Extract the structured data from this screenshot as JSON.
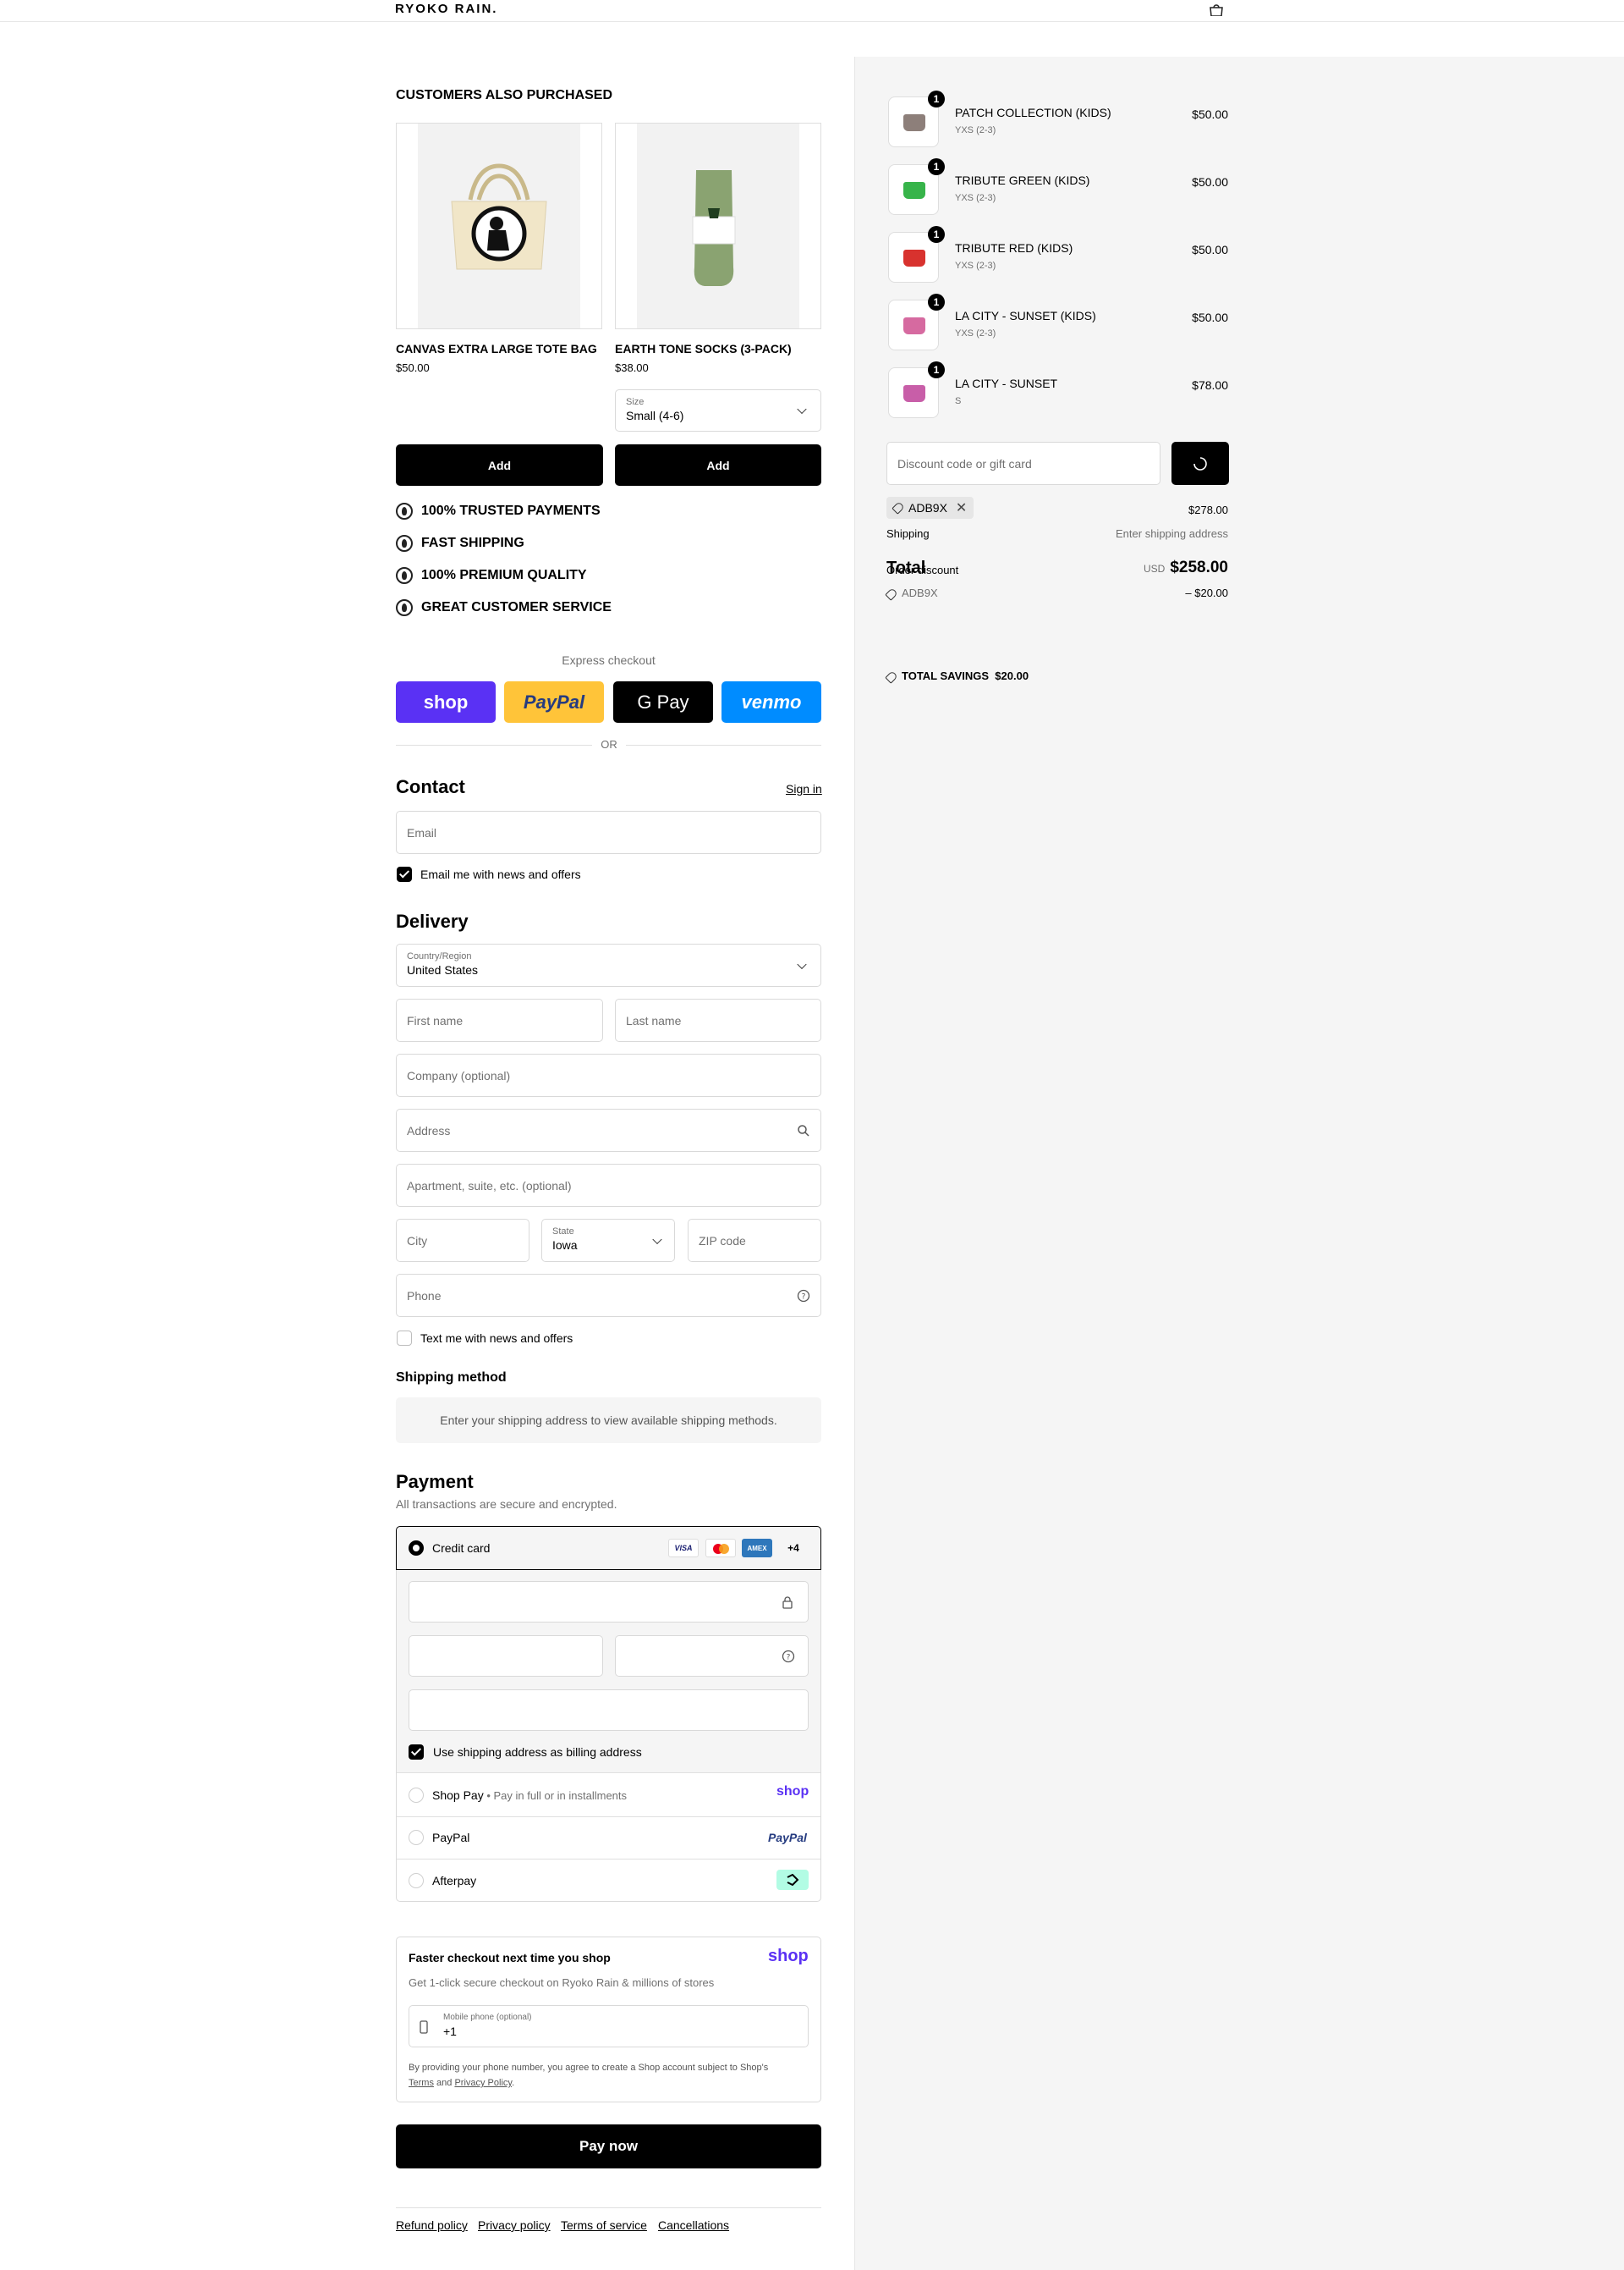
{
  "header": {
    "logo": "RYOKO RAIN."
  },
  "upsell": {
    "title": "CUSTOMERS ALSO PURCHASED",
    "products": [
      {
        "name": "CANVAS EXTRA LARGE TOTE BAG",
        "price": "$50.00",
        "add_label": "Add"
      },
      {
        "name": "EARTH TONE SOCKS (3-PACK)",
        "price": "$38.00",
        "size_label": "Size",
        "size_value": "Small (4-6)",
        "add_label": "Add"
      }
    ]
  },
  "trust": [
    "100% TRUSTED PAYMENTS",
    "FAST SHIPPING",
    "100% PREMIUM QUALITY",
    "GREAT CUSTOMER SERVICE"
  ],
  "express": {
    "title": "Express checkout",
    "buttons": [
      "shop",
      "PayPal",
      "G Pay",
      "venmo"
    ],
    "or": "OR"
  },
  "contact": {
    "title": "Contact",
    "sign_in": "Sign in",
    "email_placeholder": "Email",
    "newsletter": "Email me with news and offers"
  },
  "delivery": {
    "title": "Delivery",
    "country_label": "Country/Region",
    "country_value": "United States",
    "first_name": "First name",
    "last_name": "Last name",
    "company": "Company (optional)",
    "address": "Address",
    "apartment": "Apartment, suite, etc. (optional)",
    "city": "City",
    "state_label": "State",
    "state_value": "Iowa",
    "zip": "ZIP code",
    "phone": "Phone",
    "sms": "Text me with news and offers"
  },
  "shipping_method": {
    "title": "Shipping method",
    "notice": "Enter your shipping address to view available shipping methods."
  },
  "payment": {
    "title": "Payment",
    "subtitle": "All transactions are secure and encrypted.",
    "credit_card": "Credit card",
    "card_brands": [
      "VISA",
      "",
      "AMEX"
    ],
    "more_brands": "+4",
    "billing_same": "Use shipping address as billing address",
    "shop_pay": "Shop Pay",
    "shop_pay_sub": "Pay in full or in installments",
    "shop_pay_logo": "shop",
    "paypal": "PayPal",
    "paypal_logo": "PayPal",
    "afterpay": "Afterpay"
  },
  "shop_save": {
    "title": "Faster checkout next time you shop",
    "logo": "shop",
    "subtitle": "Get 1-click secure checkout on Ryoko Rain & millions of stores",
    "phone_label": "Mobile phone (optional)",
    "phone_value": "+1",
    "legal_pre": "By providing your phone number, you agree to create a Shop account subject to Shop's",
    "legal_terms": "Terms",
    "legal_and": "and",
    "legal_privacy": "Privacy Policy",
    "legal_end": "."
  },
  "pay_now": "Pay now",
  "footer": [
    "Refund policy",
    "Privacy policy",
    "Terms of service",
    "Cancellations"
  ],
  "summary": {
    "items": [
      {
        "qty": "1",
        "name": "PATCH COLLECTION (KIDS)",
        "variant": "YXS (2-3)",
        "price": "$50.00",
        "color": "#8d7f7a"
      },
      {
        "qty": "1",
        "name": "TRIBUTE GREEN (KIDS)",
        "variant": "YXS (2-3)",
        "price": "$50.00",
        "color": "#37b44a"
      },
      {
        "qty": "1",
        "name": "TRIBUTE RED (KIDS)",
        "variant": "YXS (2-3)",
        "price": "$50.00",
        "color": "#d8322e"
      },
      {
        "qty": "1",
        "name": "LA CITY - SUNSET (KIDS)",
        "variant": "YXS (2-3)",
        "price": "$50.00",
        "color": "#d66aa0"
      },
      {
        "qty": "1",
        "name": "LA CITY - SUNSET",
        "variant": "S",
        "price": "$78.00",
        "color": "#c85ea8"
      }
    ],
    "discount_placeholder": "Discount code or gift card",
    "code": "ADB9X",
    "subtotal": "$278.00",
    "shipping_label": "Shipping",
    "shipping_value": "Enter shipping address",
    "total_label": "Total",
    "currency": "USD",
    "total_value": "$258.00",
    "order_discount_label": "Order discount",
    "discount_code": "ADB9X",
    "discount_value": "– $20.00",
    "savings_label": "TOTAL SAVINGS",
    "savings_value": "$20.00"
  },
  "colors": {
    "shop": "#5a31f4",
    "paypal": "#ffc439",
    "venmo": "#008cff",
    "afterpay": "#b2fce4"
  }
}
